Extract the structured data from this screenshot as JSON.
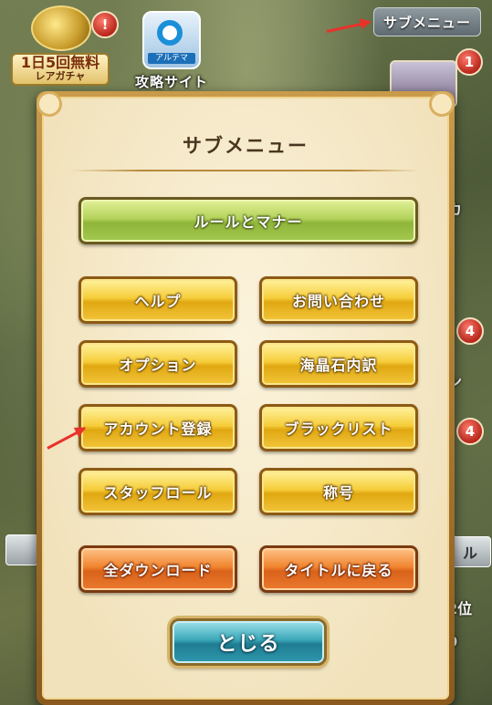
{
  "background": {
    "submenu_button": "サブメニュー",
    "gacha": {
      "label_main": "1日5回無料",
      "label_sub": "レアガチャ",
      "badge": "!"
    },
    "site": {
      "tag": "アルテマ",
      "label": "攻略サイト"
    },
    "right_badges": [
      "1",
      "4",
      "4"
    ],
    "right_texts": [
      "カ",
      "ン",
      "2位",
      "0"
    ],
    "right_panel_text": "ル"
  },
  "dialog": {
    "title": "サブメニュー",
    "rules_button": "ルールとマナー",
    "buttons": [
      {
        "label": "ヘルプ"
      },
      {
        "label": "お問い合わせ"
      },
      {
        "label": "オプション"
      },
      {
        "label": "海晶石内訳"
      },
      {
        "label": "アカウント登録"
      },
      {
        "label": "ブラックリスト"
      },
      {
        "label": "スタッフロール"
      },
      {
        "label": "称号"
      }
    ],
    "orange_buttons": [
      {
        "label": "全ダウンロード"
      },
      {
        "label": "タイトルに戻る"
      }
    ],
    "close_button": "とじる"
  },
  "colors": {
    "gold_button": "#f6cd3a",
    "green_button": "#b3d25a",
    "orange_button": "#f0842e",
    "teal_button": "#3aa7b8",
    "annotation_arrow": "#e8322a"
  }
}
